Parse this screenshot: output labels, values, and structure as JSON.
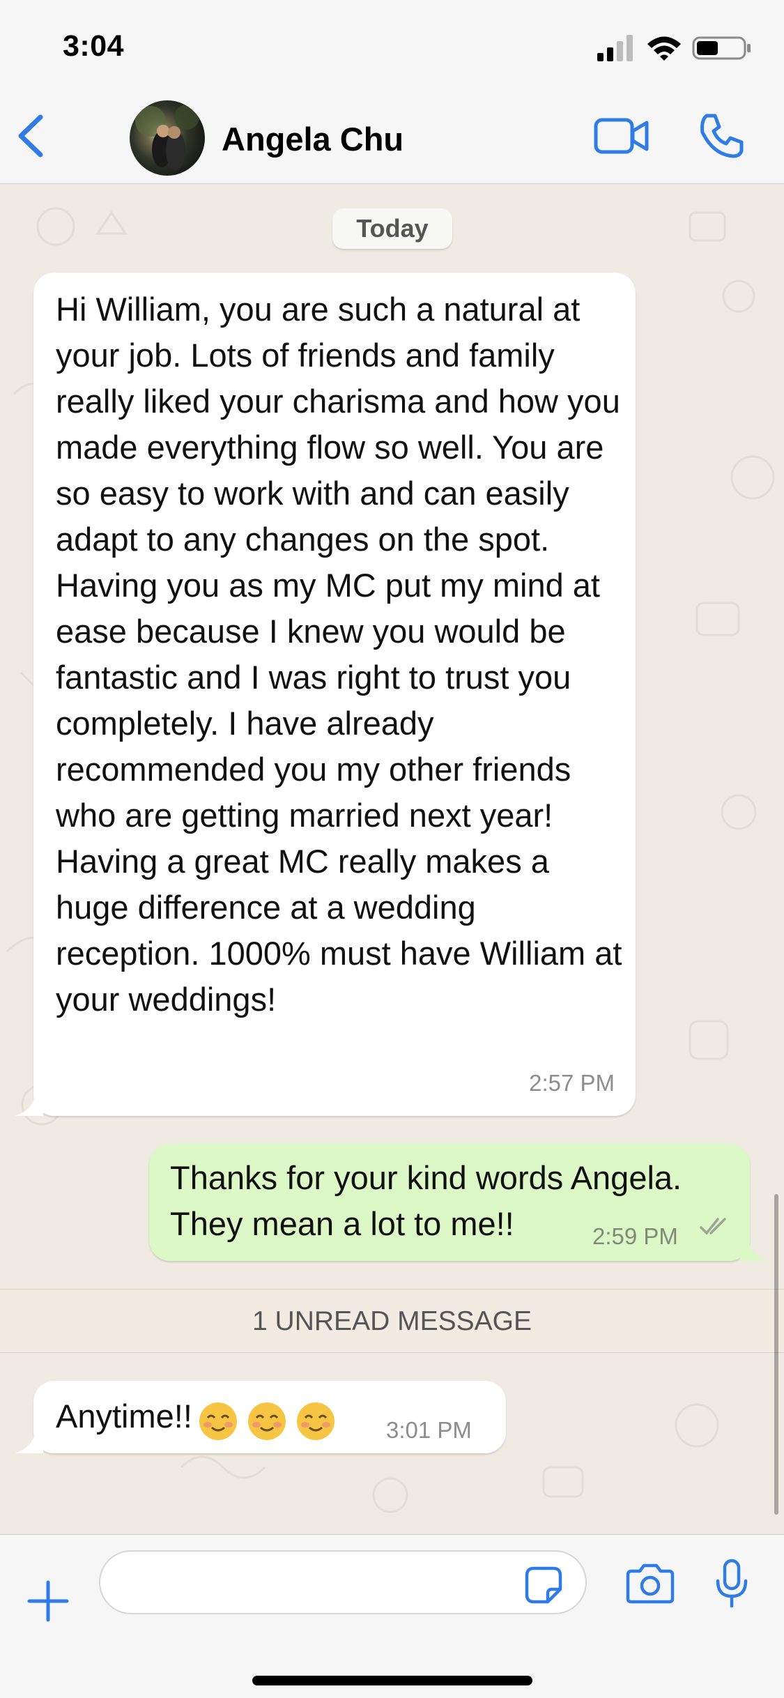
{
  "status_bar": {
    "time": "3:04",
    "icons": [
      "cellular-signal-icon",
      "wifi-icon",
      "battery-icon"
    ]
  },
  "header": {
    "contact_name": "Angela Chu",
    "back_icon": "chevron-left-icon",
    "video_icon": "video-camera-icon",
    "call_icon": "phone-icon"
  },
  "chat": {
    "date_label": "Today",
    "messages": [
      {
        "direction": "incoming",
        "text": "Hi William, you are such a natural at your job. Lots of friends and family really liked your charisma and how you made everything flow so well. You are so easy to work with and can easily adapt to any changes on the spot. Having you as my MC put my mind at ease because I knew you would be fantastic and I was right to trust you completely. I have already recommended you my other friends who are getting married next year! Having a great MC really makes a huge difference at a wedding reception. 1000% must have William at your weddings!",
        "time": "2:57 PM"
      },
      {
        "direction": "outgoing",
        "text": "Thanks for your kind words Angela. They mean a lot to me!!",
        "time": "2:59 PM",
        "status_icon": "double-check-icon"
      },
      {
        "direction": "incoming",
        "text": "Anytime!!",
        "emojis": [
          "smiling-face-icon",
          "smiling-face-icon",
          "smiling-face-icon"
        ],
        "time": "3:01 PM"
      }
    ],
    "unread_label": "1 UNREAD MESSAGE"
  },
  "composer": {
    "input_value": "",
    "icons": [
      "plus-icon",
      "sticker-icon",
      "camera-icon",
      "microphone-icon"
    ]
  },
  "colors": {
    "accent": "#2f7ce6",
    "chat_background": "#efeae2",
    "incoming_bubble": "#ffffff",
    "outgoing_bubble": "#dcf8c6"
  }
}
